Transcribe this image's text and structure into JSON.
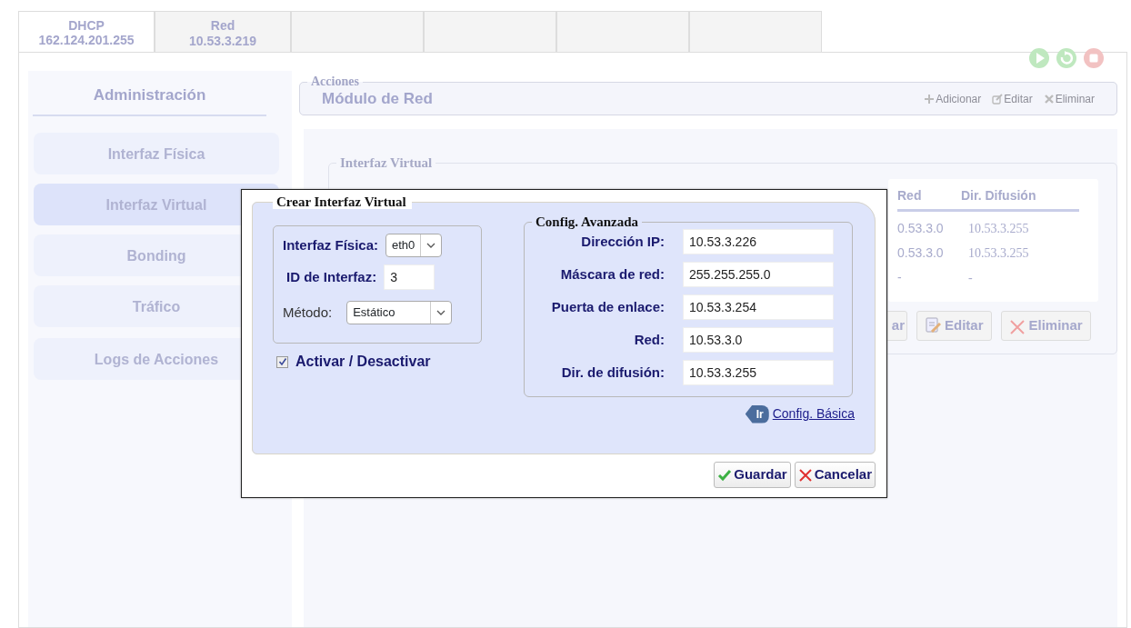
{
  "tabs": [
    {
      "title": "DHCP",
      "subtitle": "162.124.201.255",
      "selected": true
    },
    {
      "title": "Red",
      "subtitle": "10.53.3.219",
      "selected": false
    }
  ],
  "sidebar": {
    "title": "Administración",
    "items": [
      {
        "label": "Interfaz Física",
        "kind": "menu",
        "selected": false
      },
      {
        "label": "Interfaz Virtual",
        "kind": "menu",
        "selected": true
      },
      {
        "label": "Bonding",
        "kind": "menu",
        "selected": false
      },
      {
        "label": "Tráfico",
        "kind": "menu",
        "selected": false
      },
      {
        "label": "Logs de Acciones",
        "kind": "log",
        "selected": false
      }
    ]
  },
  "actions": {
    "legend": "Acciones",
    "title": "Módulo de Red",
    "toolbar": [
      {
        "label": "Adicionar",
        "kind": "add"
      },
      {
        "label": "Editar",
        "kind": "edit"
      },
      {
        "label": "Eliminar",
        "kind": "delete"
      }
    ]
  },
  "virtual_panel": {
    "legend": "Interfaz Virtual",
    "columns": [
      "Red",
      "Dir. Difusión"
    ],
    "rows": [
      [
        "0.53.3.0",
        "10.53.3.255"
      ],
      [
        "0.53.3.0",
        "10.53.3.255"
      ],
      [
        "-",
        "-"
      ]
    ],
    "buttons": [
      {
        "label": "ar",
        "kind": "plain"
      },
      {
        "label": "Editar",
        "kind": "edit"
      },
      {
        "label": "Eliminar",
        "kind": "delete"
      }
    ]
  },
  "dialog": {
    "legend": "Crear Interfaz Virtual",
    "physical": {
      "label": "Interfaz Física:",
      "value": "eth0"
    },
    "interface_id": {
      "label": "ID de Interfaz:",
      "value": "3"
    },
    "method": {
      "label": "Método:",
      "value": "Estático"
    },
    "active": {
      "label": "Activar / Desactivar",
      "checked": true
    },
    "advanced": {
      "legend": "Config. Avanzada",
      "fields": [
        {
          "label": "Dirección IP:",
          "value": "10.53.3.226"
        },
        {
          "label": "Máscara de red:",
          "value": "255.255.255.0"
        },
        {
          "label": "Puerta de enlace:",
          "value": "10.53.3.254"
        },
        {
          "label": "Red:",
          "value": "10.53.3.0"
        },
        {
          "label": "Dir. de difusión:",
          "value": "10.53.3.255"
        }
      ]
    },
    "go_badge": "Ir",
    "link": "Config. Básica",
    "buttons": [
      {
        "label": "Guardar",
        "kind": "save"
      },
      {
        "label": "Cancelar",
        "kind": "cancel"
      }
    ]
  }
}
